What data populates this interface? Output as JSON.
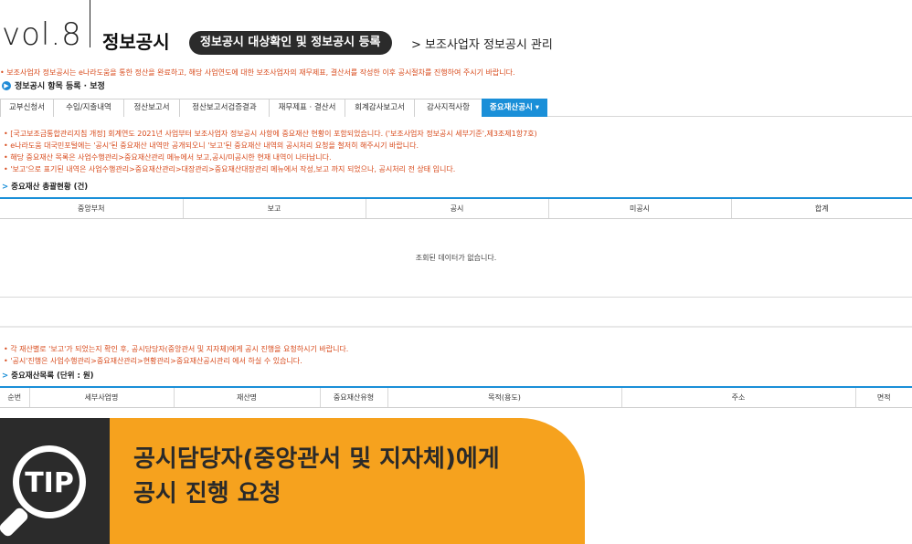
{
  "header": {
    "vol": "vol.8",
    "title": "정보공시",
    "pill": "정보공시 대상확인 및 정보공시 등록",
    "breadcrumb": "> 보조사업자 정보공시 관리"
  },
  "notice_top": "• 보조사업자 정보공시는 e나라도움을 통한 정산을 완료하고, 해당 사업연도에 대한 보조사업자의 재무제표, 결산서를 작성한 이후 공시절차를 진행하여 주시기 바랍니다.",
  "section1": "정보공시 항목 등록 · 보정",
  "tabs": [
    {
      "label": "교부신청서"
    },
    {
      "label": "수입/지출내역"
    },
    {
      "label": "정산보고서"
    },
    {
      "label": "정산보고서검증결과"
    },
    {
      "label": "재무제표 · 결산서"
    },
    {
      "label": "회계감사보고서"
    },
    {
      "label": "감사지적사항"
    },
    {
      "label": "중요재산공시 ▾"
    }
  ],
  "notes2": [
    "• [국고보조금통합관리지침 개정] 회계연도 2021년 사업부터 보조사업자 정보공시 사항에 중요재산 현황이 포함되었습니다. ('보조사업자 정보공시 세부기준',제3조제1항7호)",
    "• e나라도움 대국민포털에는 '공시'된 중요재산 내역만 공개되오니 '보고'된 중요재산 내역의 공시처리 요청을 철저히 해주시기 바랍니다.",
    "• 해당 중요재산 목록은 사업수행관리>중요재산관리 메뉴에서 보고,공시/미공시한 현재 내역이 나타납니다.",
    "• '보고'으로 표기된 내역은 사업수행관리>중요재산관리>대장관리>중요재산대장관리 메뉴에서 작성,보고 까지 되었으나, 공시처리 전 상태 입니다."
  ],
  "section2": "중요재산 총괄현황 (건)",
  "summary_table": {
    "headers": [
      "중앙부처",
      "보고",
      "공시",
      "미공시",
      "합계"
    ],
    "empty_message": "조회된 데이터가 없습니다."
  },
  "notes3": [
    "• 각 재산별로 '보고'가 되었는지 확인 후, 공시담당자(중앙관서 및 지자체)에게 공시 진행을 요청하시기 바랍니다.",
    "• '공시'진행은 사업수행관리>중요재산관리>현황관리>중요재산공시관리 에서 하실 수 있습니다."
  ],
  "section3": "중요재산목록 (단위 : 원)",
  "list_table": {
    "headers": [
      "순번",
      "세부사업명",
      "재산명",
      "중요재산유형",
      "목적(용도)",
      "주소",
      "면적"
    ]
  },
  "tip": {
    "badge": "TIP",
    "line1": "공시담당자(중앙관서 및 지자체)에게",
    "line2": "공시 진행 요청"
  },
  "colors": {
    "accent": "#1a8fd8",
    "notice_red": "#d84a1b",
    "tip_yellow": "#f6a21e",
    "tip_dark": "#2b2b2b"
  }
}
